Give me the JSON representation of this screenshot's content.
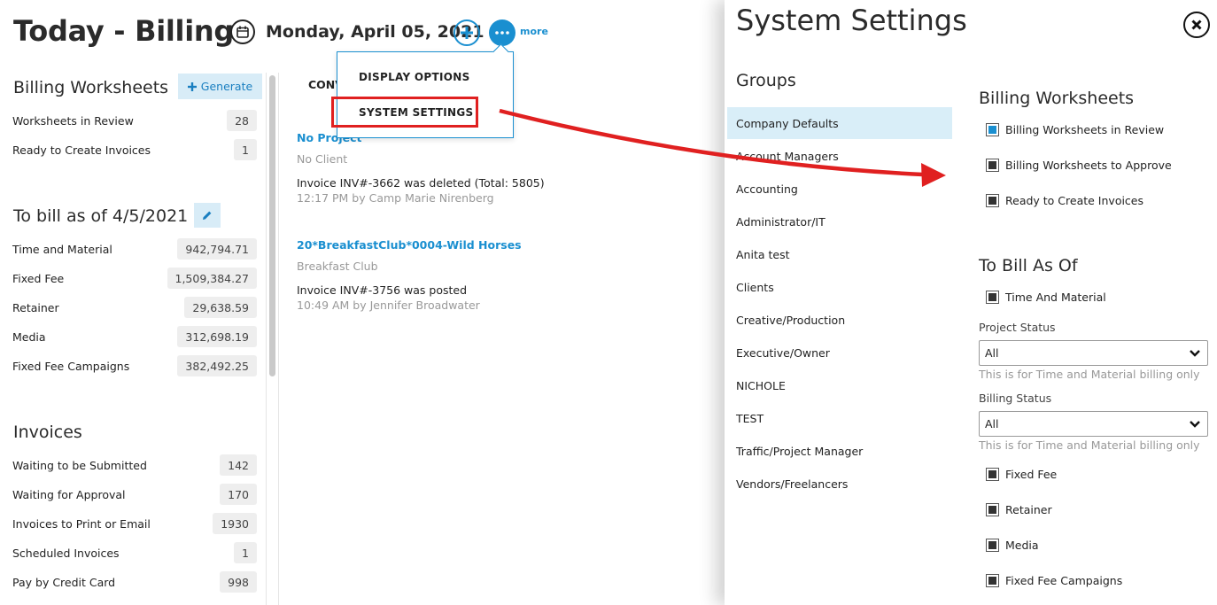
{
  "header": {
    "title": "Today - Billing",
    "date": "Monday, April 05, 2021",
    "more_label": "more"
  },
  "menu": {
    "display_options": "DISPLAY OPTIONS",
    "system_settings": "SYSTEM SETTINGS"
  },
  "worksheets": {
    "title": "Billing Worksheets",
    "generate_label": "Generate",
    "rows": [
      {
        "label": "Worksheets in Review",
        "value": "28"
      },
      {
        "label": "Ready to Create Invoices",
        "value": "1"
      }
    ]
  },
  "to_bill": {
    "title": "To bill as of 4/5/2021",
    "rows": [
      {
        "label": "Time and Material",
        "value": "942,794.71"
      },
      {
        "label": "Fixed Fee",
        "value": "1,509,384.27"
      },
      {
        "label": "Retainer",
        "value": "29,638.59"
      },
      {
        "label": "Media",
        "value": "312,698.19"
      },
      {
        "label": "Fixed Fee Campaigns",
        "value": "382,492.25"
      }
    ]
  },
  "invoices": {
    "title": "Invoices",
    "rows": [
      {
        "label": "Waiting to be Submitted",
        "value": "142"
      },
      {
        "label": "Waiting for Approval",
        "value": "170"
      },
      {
        "label": "Invoices to Print or Email",
        "value": "1930"
      },
      {
        "label": "Scheduled Invoices",
        "value": "1"
      },
      {
        "label": "Pay by Credit Card",
        "value": "998"
      }
    ]
  },
  "feed": {
    "tab_label": "CONV",
    "items": [
      {
        "title": "No Project",
        "client": "No Client",
        "message": "Invoice INV#-3662 was deleted (Total: 5805)",
        "meta": "12:17 PM by Camp Marie Nirenberg"
      },
      {
        "title": "20*BreakfastClub*0004-Wild Horses",
        "client": "Breakfast Club",
        "message": "Invoice INV#-3756 was posted",
        "meta": "10:49 AM by Jennifer Broadwater"
      }
    ]
  },
  "settings": {
    "title": "System Settings",
    "groups_title": "Groups",
    "groups": [
      "Company Defaults",
      "Account Managers",
      "Accounting",
      "Administrator/IT",
      "Anita test",
      "Clients",
      "Creative/Production",
      "Executive/Owner",
      "NICHOLE",
      "TEST",
      "Traffic/Project Manager",
      "Vendors/Freelancers"
    ],
    "worksheets_title": "Billing Worksheets",
    "worksheet_options": [
      "Billing Worksheets in Review",
      "Billing Worksheets to Approve",
      "Ready to Create Invoices"
    ],
    "to_bill_title": "To Bill As Of",
    "time_material_label": "Time And Material",
    "project_status_label": "Project Status",
    "project_status_value": "All",
    "project_status_hint": "This is for Time and Material billing only",
    "billing_status_label": "Billing Status",
    "billing_status_value": "All",
    "billing_status_hint": "This is for Time and Material billing only",
    "other_options": [
      "Fixed Fee",
      "Retainer",
      "Media",
      "Fixed Fee Campaigns"
    ]
  },
  "colors": {
    "accent": "#1a8fd0",
    "highlight_red": "#e02020",
    "active_group_bg": "#d9eef8"
  }
}
